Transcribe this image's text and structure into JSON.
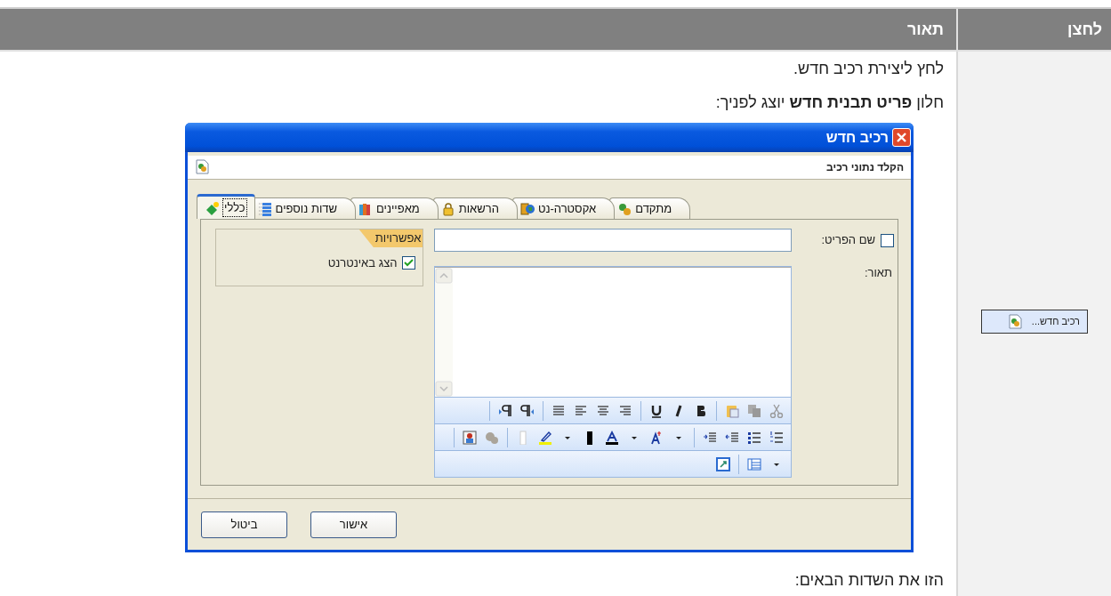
{
  "table": {
    "columns": [
      {
        "label": "לחצן"
      },
      {
        "label": "תאור"
      }
    ],
    "button_cell": {
      "label": "רכיב חדש..."
    },
    "description": {
      "lines": [
        "לחץ ליצירת רכיב חדש.",
        "חלון **פריט תבנית חדש** יוצג לפניך:"
      ],
      "footer": "הזו את השדות הבאים:"
    }
  },
  "dialog": {
    "title": "רכיב חדש",
    "subtitle": "הקלד נתוני רכיב",
    "tabs": [
      {
        "label": "מתקדם",
        "selected": false
      },
      {
        "label": "אקסטרה-נט",
        "selected": false
      },
      {
        "label": "הרשאות",
        "selected": false
      },
      {
        "label": "מאפיינים",
        "selected": false
      },
      {
        "label": "שדות נוספים",
        "selected": false
      },
      {
        "label": "כללי",
        "selected": true
      }
    ],
    "name_field": {
      "label": "שם הפריט:",
      "checked": false
    },
    "description_field": {
      "label": "תאור:"
    },
    "options": {
      "title": "אפשרויות",
      "items": [
        {
          "label": "הצג באינטרנט",
          "checked": true
        }
      ]
    },
    "buttons": [
      {
        "label": "אישור"
      },
      {
        "label": "ביטול"
      }
    ]
  }
}
